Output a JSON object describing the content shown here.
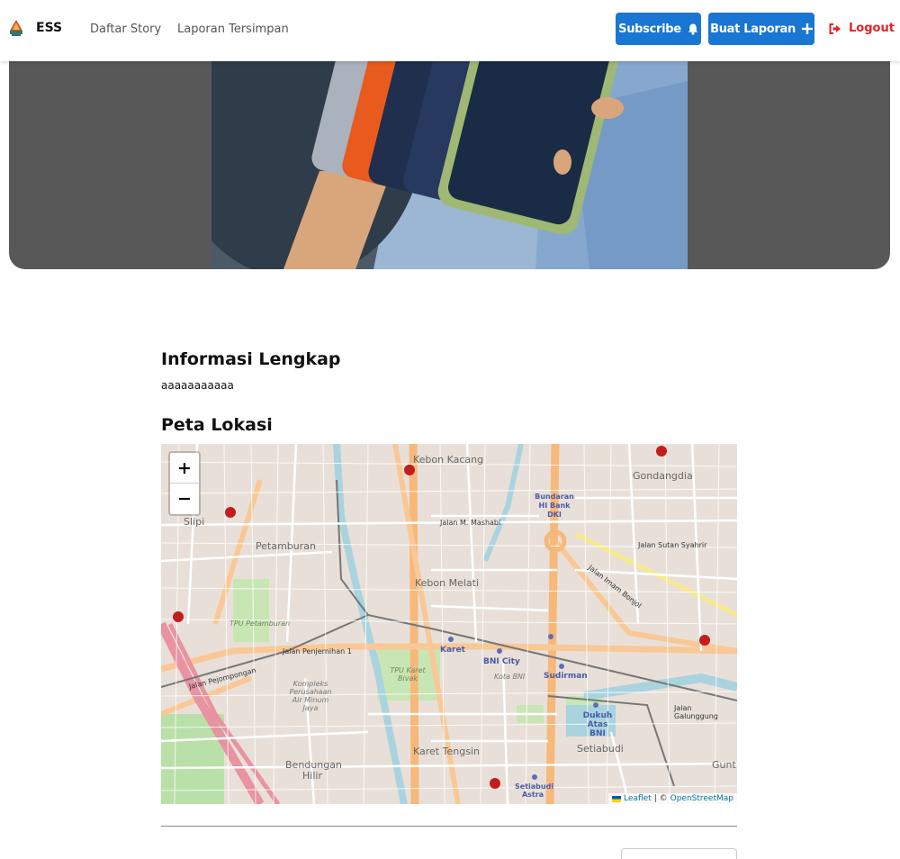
{
  "header": {
    "brand": "ESS",
    "nav": [
      "Daftar Story",
      "Laporan Tersimpan"
    ],
    "subscribe_label": "Subscribe",
    "create_label": "Buat Laporan",
    "logout_label": "Logout",
    "accent": "#1976d2",
    "danger": "#e02424"
  },
  "detail": {
    "info_heading": "Informasi Lengkap",
    "description": "aaaaaaaaaaa",
    "map_heading": "Peta Lokasi"
  },
  "map": {
    "zoom_in": "+",
    "zoom_out": "−",
    "attribution_leaflet": "Leaflet",
    "attribution_sep": "| ©",
    "attribution_osm": "OpenStreetMap",
    "place_labels": [
      "Kebon Kacang",
      "Gondangdia",
      "Slipi",
      "Petamburan",
      "Kebon Melati",
      "Karet",
      "BNI City",
      "Sudirman",
      "Dukuh Atas BNI",
      "Karet Tengsin",
      "Setiabudi",
      "Bendungan Hilir",
      "TPU Karet Bivak",
      "TPU Petamburan",
      "Bundaran HI Bank DKI",
      "Setiabudi Astra",
      "Kota BNI",
      "Jalan M. Mashabi",
      "Jalan Sutan Syahrir",
      "Jalan Imam Bonjol",
      "Jalan Penjernihan 1",
      "Jalan Pejompongan",
      "Jalan Galunggung",
      "Kompleks Perusahaan Air Minum Jaya",
      "Gunt"
    ]
  }
}
